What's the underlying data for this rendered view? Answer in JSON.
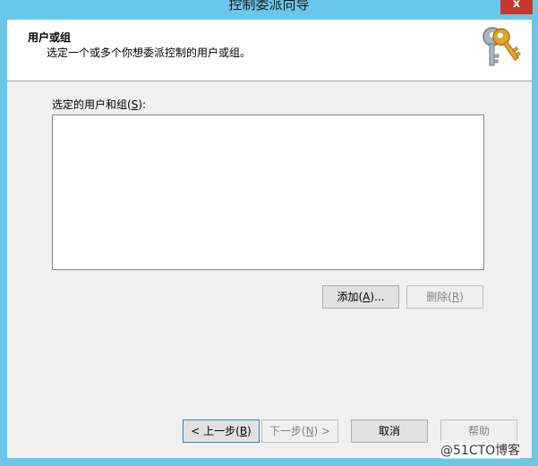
{
  "window": {
    "title": "控制委派向导",
    "close_glyph": "x"
  },
  "header": {
    "title": "用户或组",
    "subtitle": "选定一个或多个你想委派控制的用户或组。",
    "icon": "keys-icon"
  },
  "list": {
    "label_prefix": "选定的用户和组(",
    "label_accel": "S",
    "label_suffix": "):",
    "items": []
  },
  "buttons": {
    "add": {
      "prefix": "添加(",
      "accel": "A",
      "suffix": ")..."
    },
    "remove": {
      "prefix": "删除(",
      "accel": "R",
      "suffix": ")"
    },
    "back": {
      "prefix": "< 上一步(",
      "accel": "B",
      "suffix": ")"
    },
    "next": {
      "prefix": "下一步(",
      "accel": "N",
      "suffix": ") >"
    },
    "cancel": {
      "label": "取消"
    },
    "help": {
      "label": "帮助"
    }
  },
  "watermark": "@51CTO博客",
  "colors": {
    "titlebar": "#6ac7ea",
    "close": "#c7392e",
    "key_gold": "#e0a62a",
    "key_silver": "#a9b4bd"
  }
}
